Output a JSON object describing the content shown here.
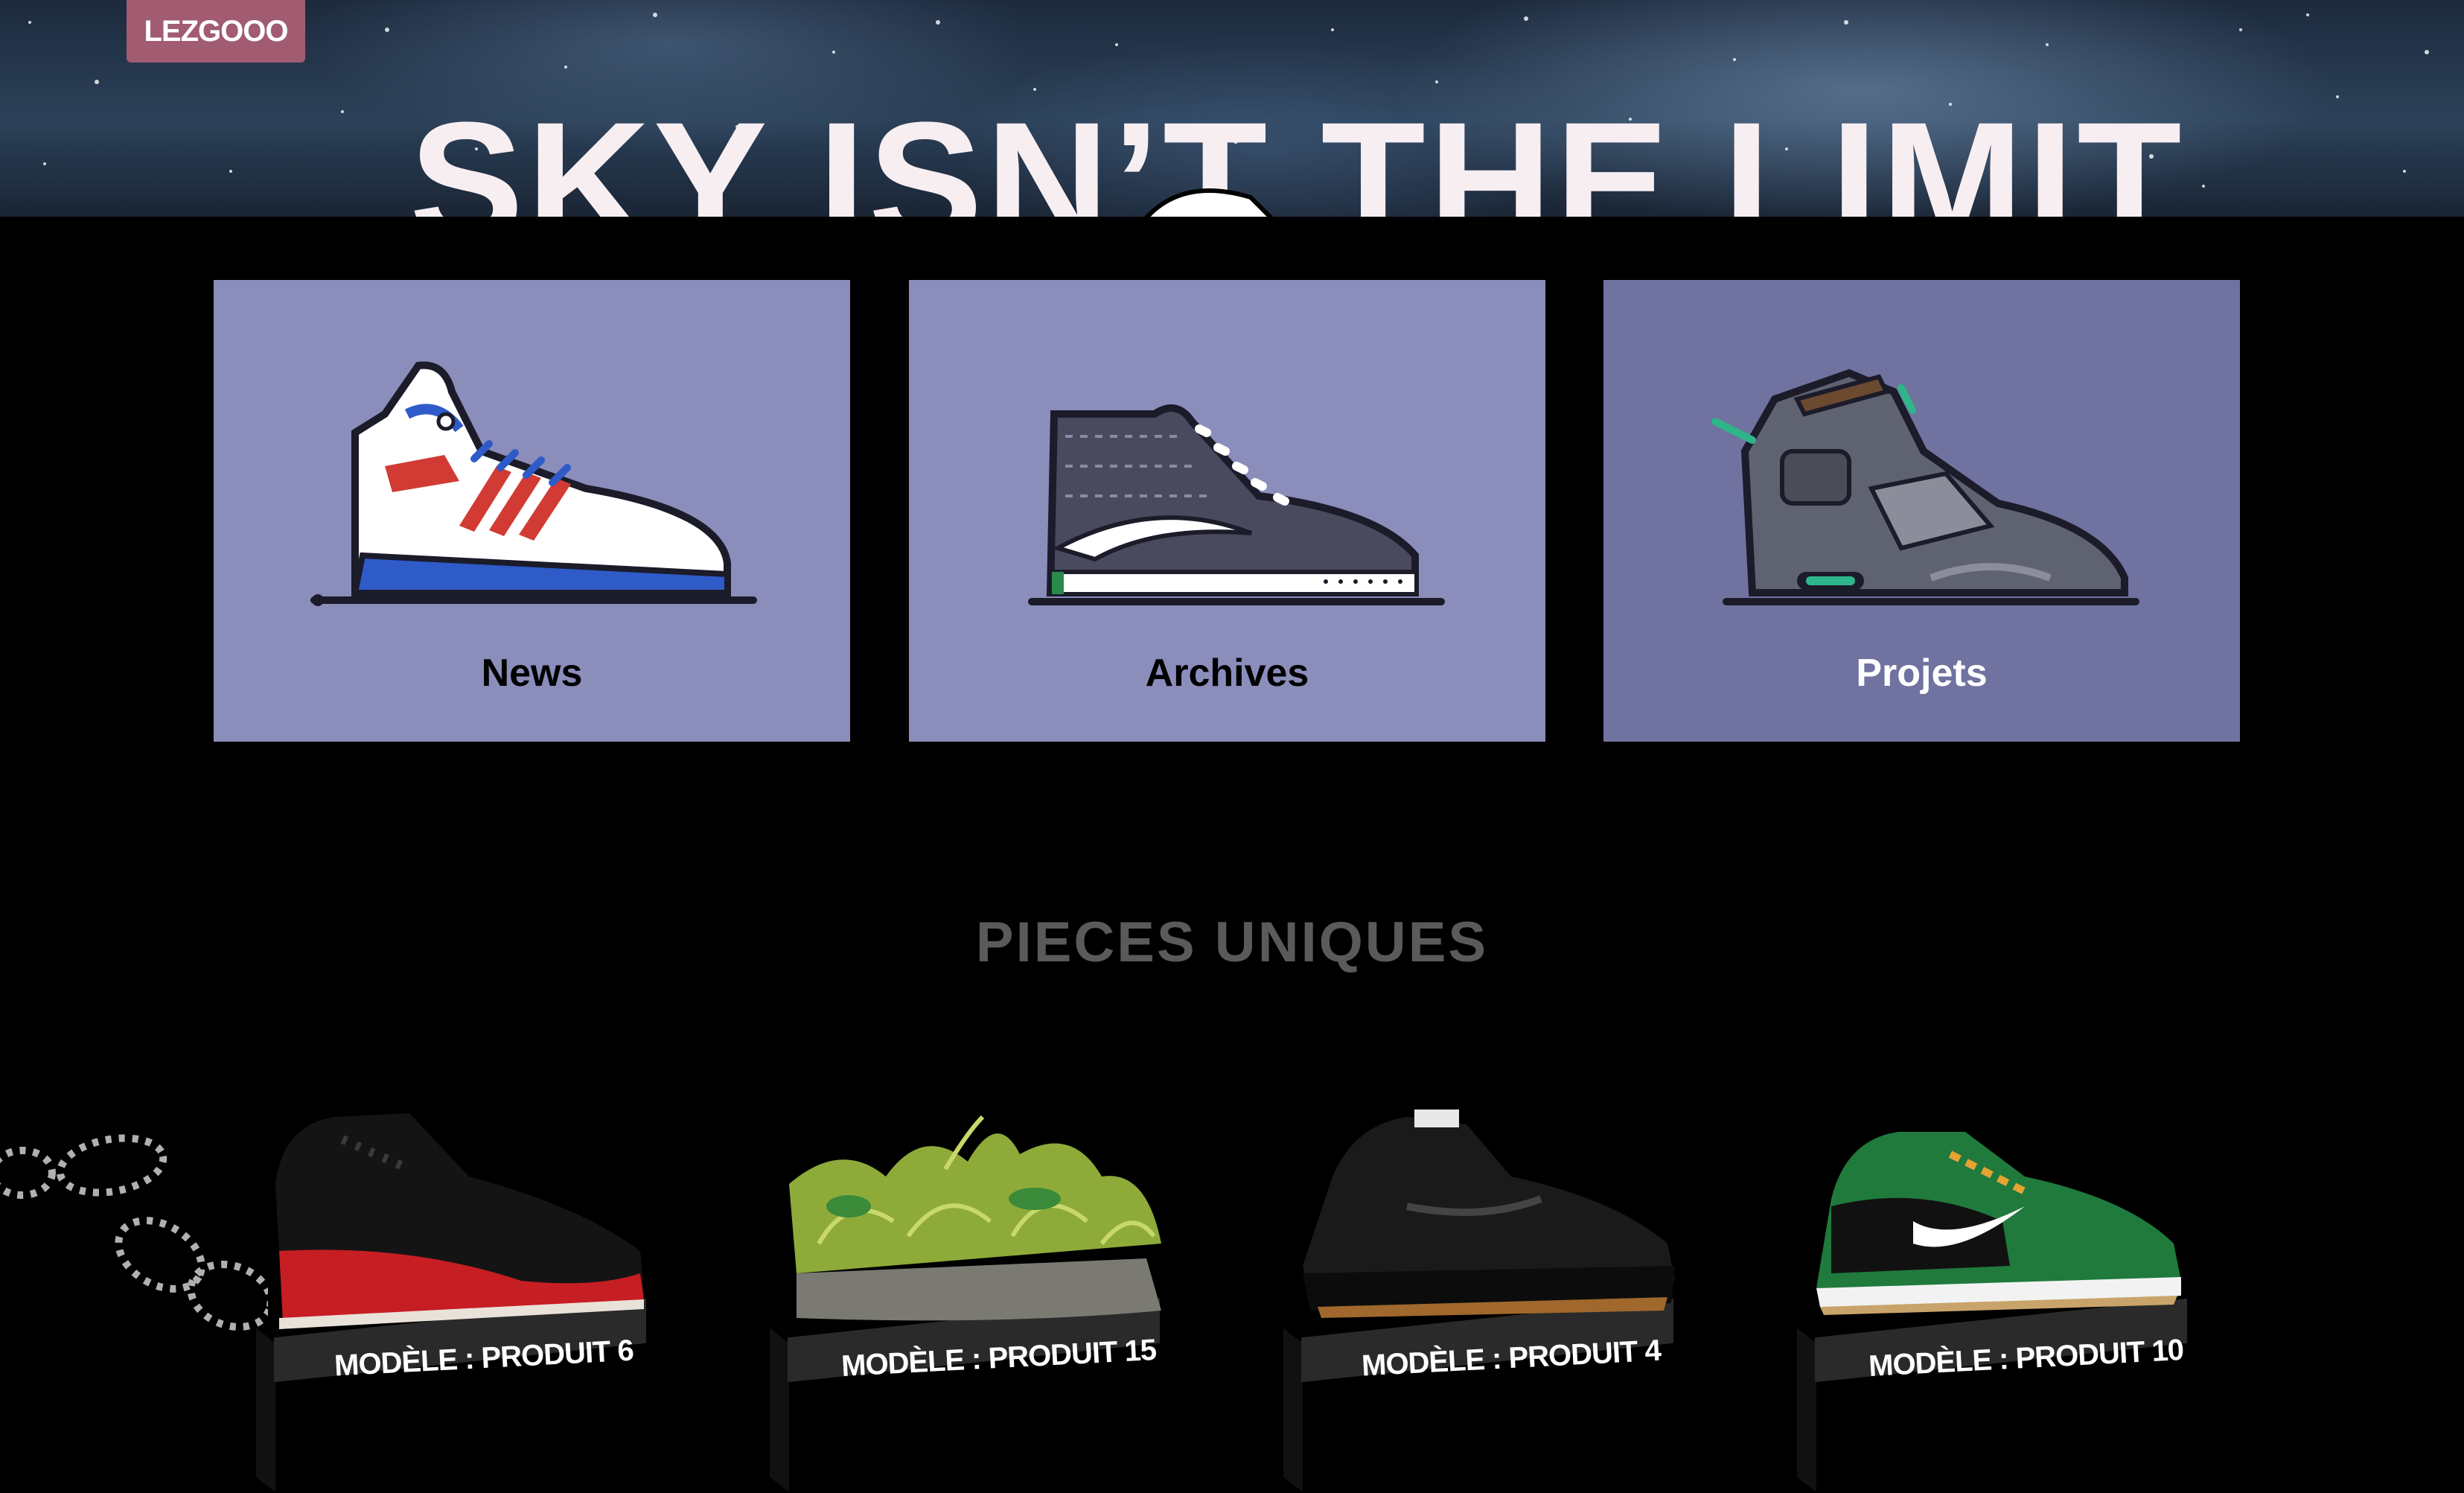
{
  "hero": {
    "brand": "LEZGOOO",
    "title": "SKY ISN’T THE LIMIT"
  },
  "categories": [
    {
      "label": "News",
      "icon": "sneaker-hightop-icon"
    },
    {
      "label": "Archives",
      "icon": "sneaker-skate-icon"
    },
    {
      "label": "Projets",
      "icon": "sneaker-jordan-icon"
    }
  ],
  "section": {
    "title": "PIECES UNIQUES"
  },
  "products": [
    {
      "label": "MODÈLE : PRODUIT 6",
      "image": "red-black-sneaker"
    },
    {
      "label": "MODÈLE : PRODUIT 15",
      "image": "green-fur-sneaker"
    },
    {
      "label": "MODÈLE : PRODUIT 4",
      "image": "black-runner-sneaker"
    },
    {
      "label": "MODÈLE : PRODUIT 10",
      "image": "green-black-low-sneaker"
    }
  ],
  "colors": {
    "brand": "#a15c71",
    "card": "#8b8dbb",
    "card_active": "#7072a0",
    "section_title": "#5a5a5a"
  }
}
